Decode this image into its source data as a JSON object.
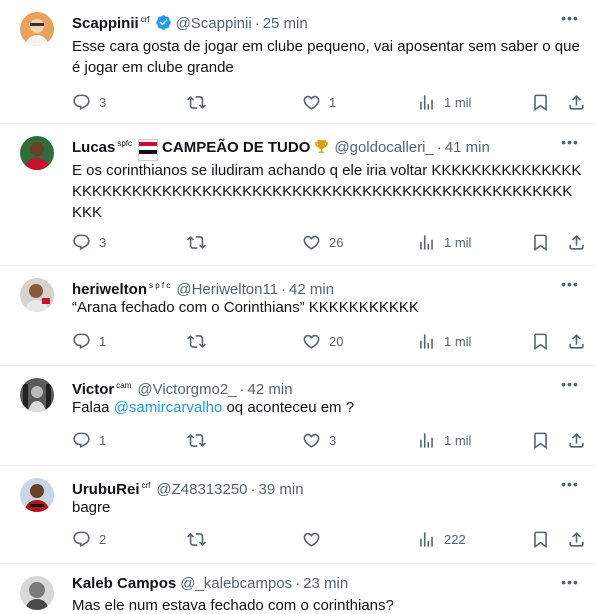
{
  "tweets": [
    {
      "name": "Scappinii",
      "name_suffix": "crf",
      "verified": true,
      "handle": "@Scappinii",
      "time": "25 min",
      "text": "Esse cara gosta de jogar em clube pequeno, vai aposentar sem saber o que é jogar em clube grande",
      "replies": "3",
      "retweets": "",
      "likes": "1",
      "views": "1 mil"
    },
    {
      "name": "Lucas",
      "name_suffix": "spfc",
      "name_tail": "CAMPEÃO DE TUDO",
      "handle": "@goldocalleri_",
      "time": "41 min",
      "text": "E os corinthianos se iludiram achando q ele iria voltar KKKKKKKKKKKKKKKKKKKKKKKKKKKKKKKKKKKKKKKKKKKKKKKKKKKKKKKKKKKKKKKKKKKK",
      "replies": "3",
      "retweets": "",
      "likes": "26",
      "views": "1 mil"
    },
    {
      "name": "heriwelton",
      "name_suffix": "s p f c",
      "handle": "@Heriwelton11",
      "time": "42 min",
      "text": "“Arana fechado com o Corinthians” KKKKKKKKKKK",
      "replies": "1",
      "retweets": "",
      "likes": "20",
      "views": "1 mil"
    },
    {
      "name": "Victor",
      "name_suffix": "cam",
      "handle": "@Victorgmo2_",
      "time": "42 min",
      "text_before": "Falaa ",
      "mention": "@samircarvalho",
      "text_after": " oq aconteceu em ?",
      "replies": "1",
      "retweets": "",
      "likes": "3",
      "views": "1 mil"
    },
    {
      "name": "UrubuRei",
      "name_suffix": "crf",
      "handle": "@Z48313250",
      "time": "39 min",
      "text": "bagre",
      "replies": "2",
      "retweets": "",
      "likes": "",
      "views": "222"
    },
    {
      "name": "Kaleb Campos",
      "handle": "@_kalebcampos",
      "time": "23 min",
      "text": "Mas ele num estava fechado com o corinthians?"
    }
  ],
  "separator": "·",
  "more_glyph": "•••",
  "colors": {
    "text": "#0f1419",
    "secondary": "#536471",
    "link": "#1d9bf0",
    "verified": "#1d9bf0",
    "divider": "#eff3f4"
  },
  "icons": [
    "reply-icon",
    "retweet-icon",
    "like-icon",
    "views-icon",
    "bookmark-icon",
    "share-icon",
    "verified-badge-icon",
    "more-icon",
    "flag-icon",
    "trophy-icon"
  ]
}
